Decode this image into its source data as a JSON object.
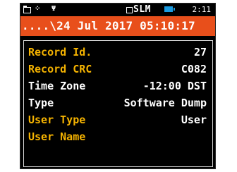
{
  "status_bar": {
    "folder_icon": "folder-icon",
    "button_icon": "keypad-icon",
    "antenna_icon": "antenna-icon",
    "mode": "SLM",
    "battery_color": "#1b9be0",
    "time": "2:11"
  },
  "header": {
    "title": "....\\24 Jul 2017 05:10:17",
    "background": "#e84f1b"
  },
  "fields": [
    {
      "label": "Record Id.",
      "value": "27"
    },
    {
      "label": "Record CRC",
      "value": "C082"
    },
    {
      "label": "Time Zone",
      "value": "-12:00 DST"
    },
    {
      "label": "Type",
      "value": "Software Dump"
    },
    {
      "label": "User Type",
      "value": "User"
    },
    {
      "label": "User Name",
      "value": ""
    }
  ],
  "colors": {
    "label": "#f5b301",
    "label_alt": "#ffffff",
    "value": "#ffffff",
    "background": "#000000"
  }
}
